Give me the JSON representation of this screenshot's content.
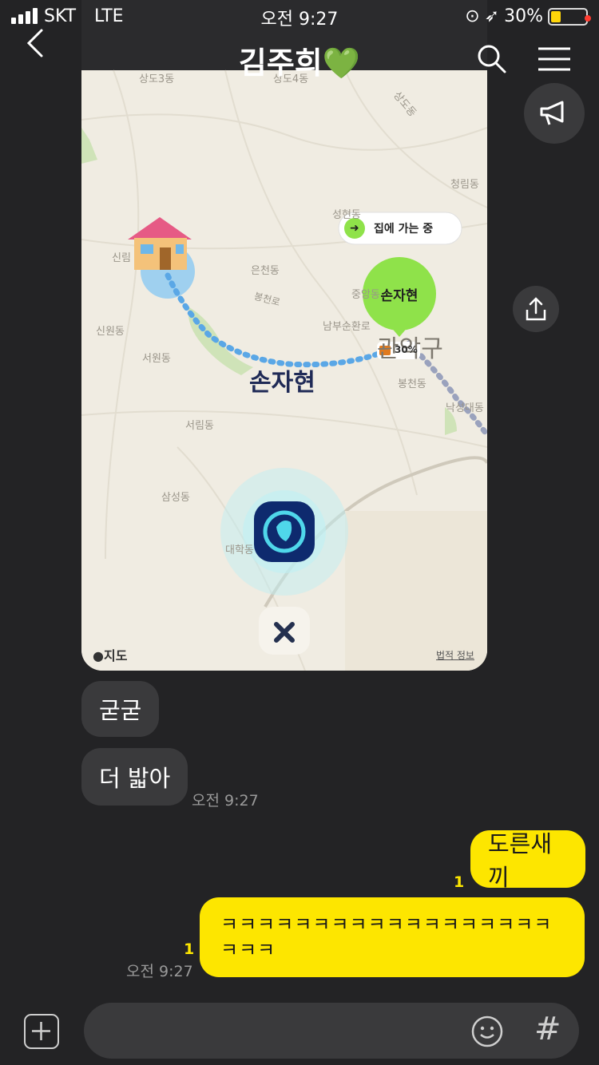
{
  "status_bar": {
    "carrier": "SKT",
    "network": "LTE",
    "time": "오전 9:27",
    "battery_percent": "30%",
    "battery_level": 0.3
  },
  "header": {
    "title": "김주희💚"
  },
  "map": {
    "place_labels": [
      "상도3동",
      "상도4동",
      "상도동",
      "청림동",
      "성현동",
      "신림",
      "은천동",
      "중앙동",
      "봉천로",
      "남부순환로",
      "관악구",
      "신원동",
      "서원동",
      "봉천동",
      "낙성대동",
      "서림동",
      "삼성동",
      "대학동"
    ],
    "user_name": "손자현",
    "pin_name": "손자현",
    "status_chip": "집에 가는 중",
    "battery_badge": "30%",
    "attribution_brand": "지도",
    "legal_link": "법적 정보",
    "close_icon": "close-icon"
  },
  "side_actions": {
    "announce_icon": "megaphone-icon",
    "share_icon": "share-icon"
  },
  "messages": [
    {
      "side": "in",
      "text": "굳굳"
    },
    {
      "side": "in",
      "text": "더 밟아",
      "time": "오전 9:27"
    },
    {
      "side": "out",
      "text": "도른새끼",
      "unread": "1"
    },
    {
      "side": "out",
      "text": "ㅋㅋㅋㅋㅋㅋㅋㅋㅋㅋㅋㅋㅋㅋㅋㅋㅋㅋ\nㅋㅋㅋ",
      "unread": "1",
      "time": "오전 9:27"
    }
  ],
  "input_bar": {
    "placeholder": "",
    "emoji_icon": "emoji-icon",
    "hash_label": "#"
  },
  "colors": {
    "background": "#232325",
    "incoming_bubble": "#3a3a3c",
    "outgoing_bubble": "#fde600"
  }
}
